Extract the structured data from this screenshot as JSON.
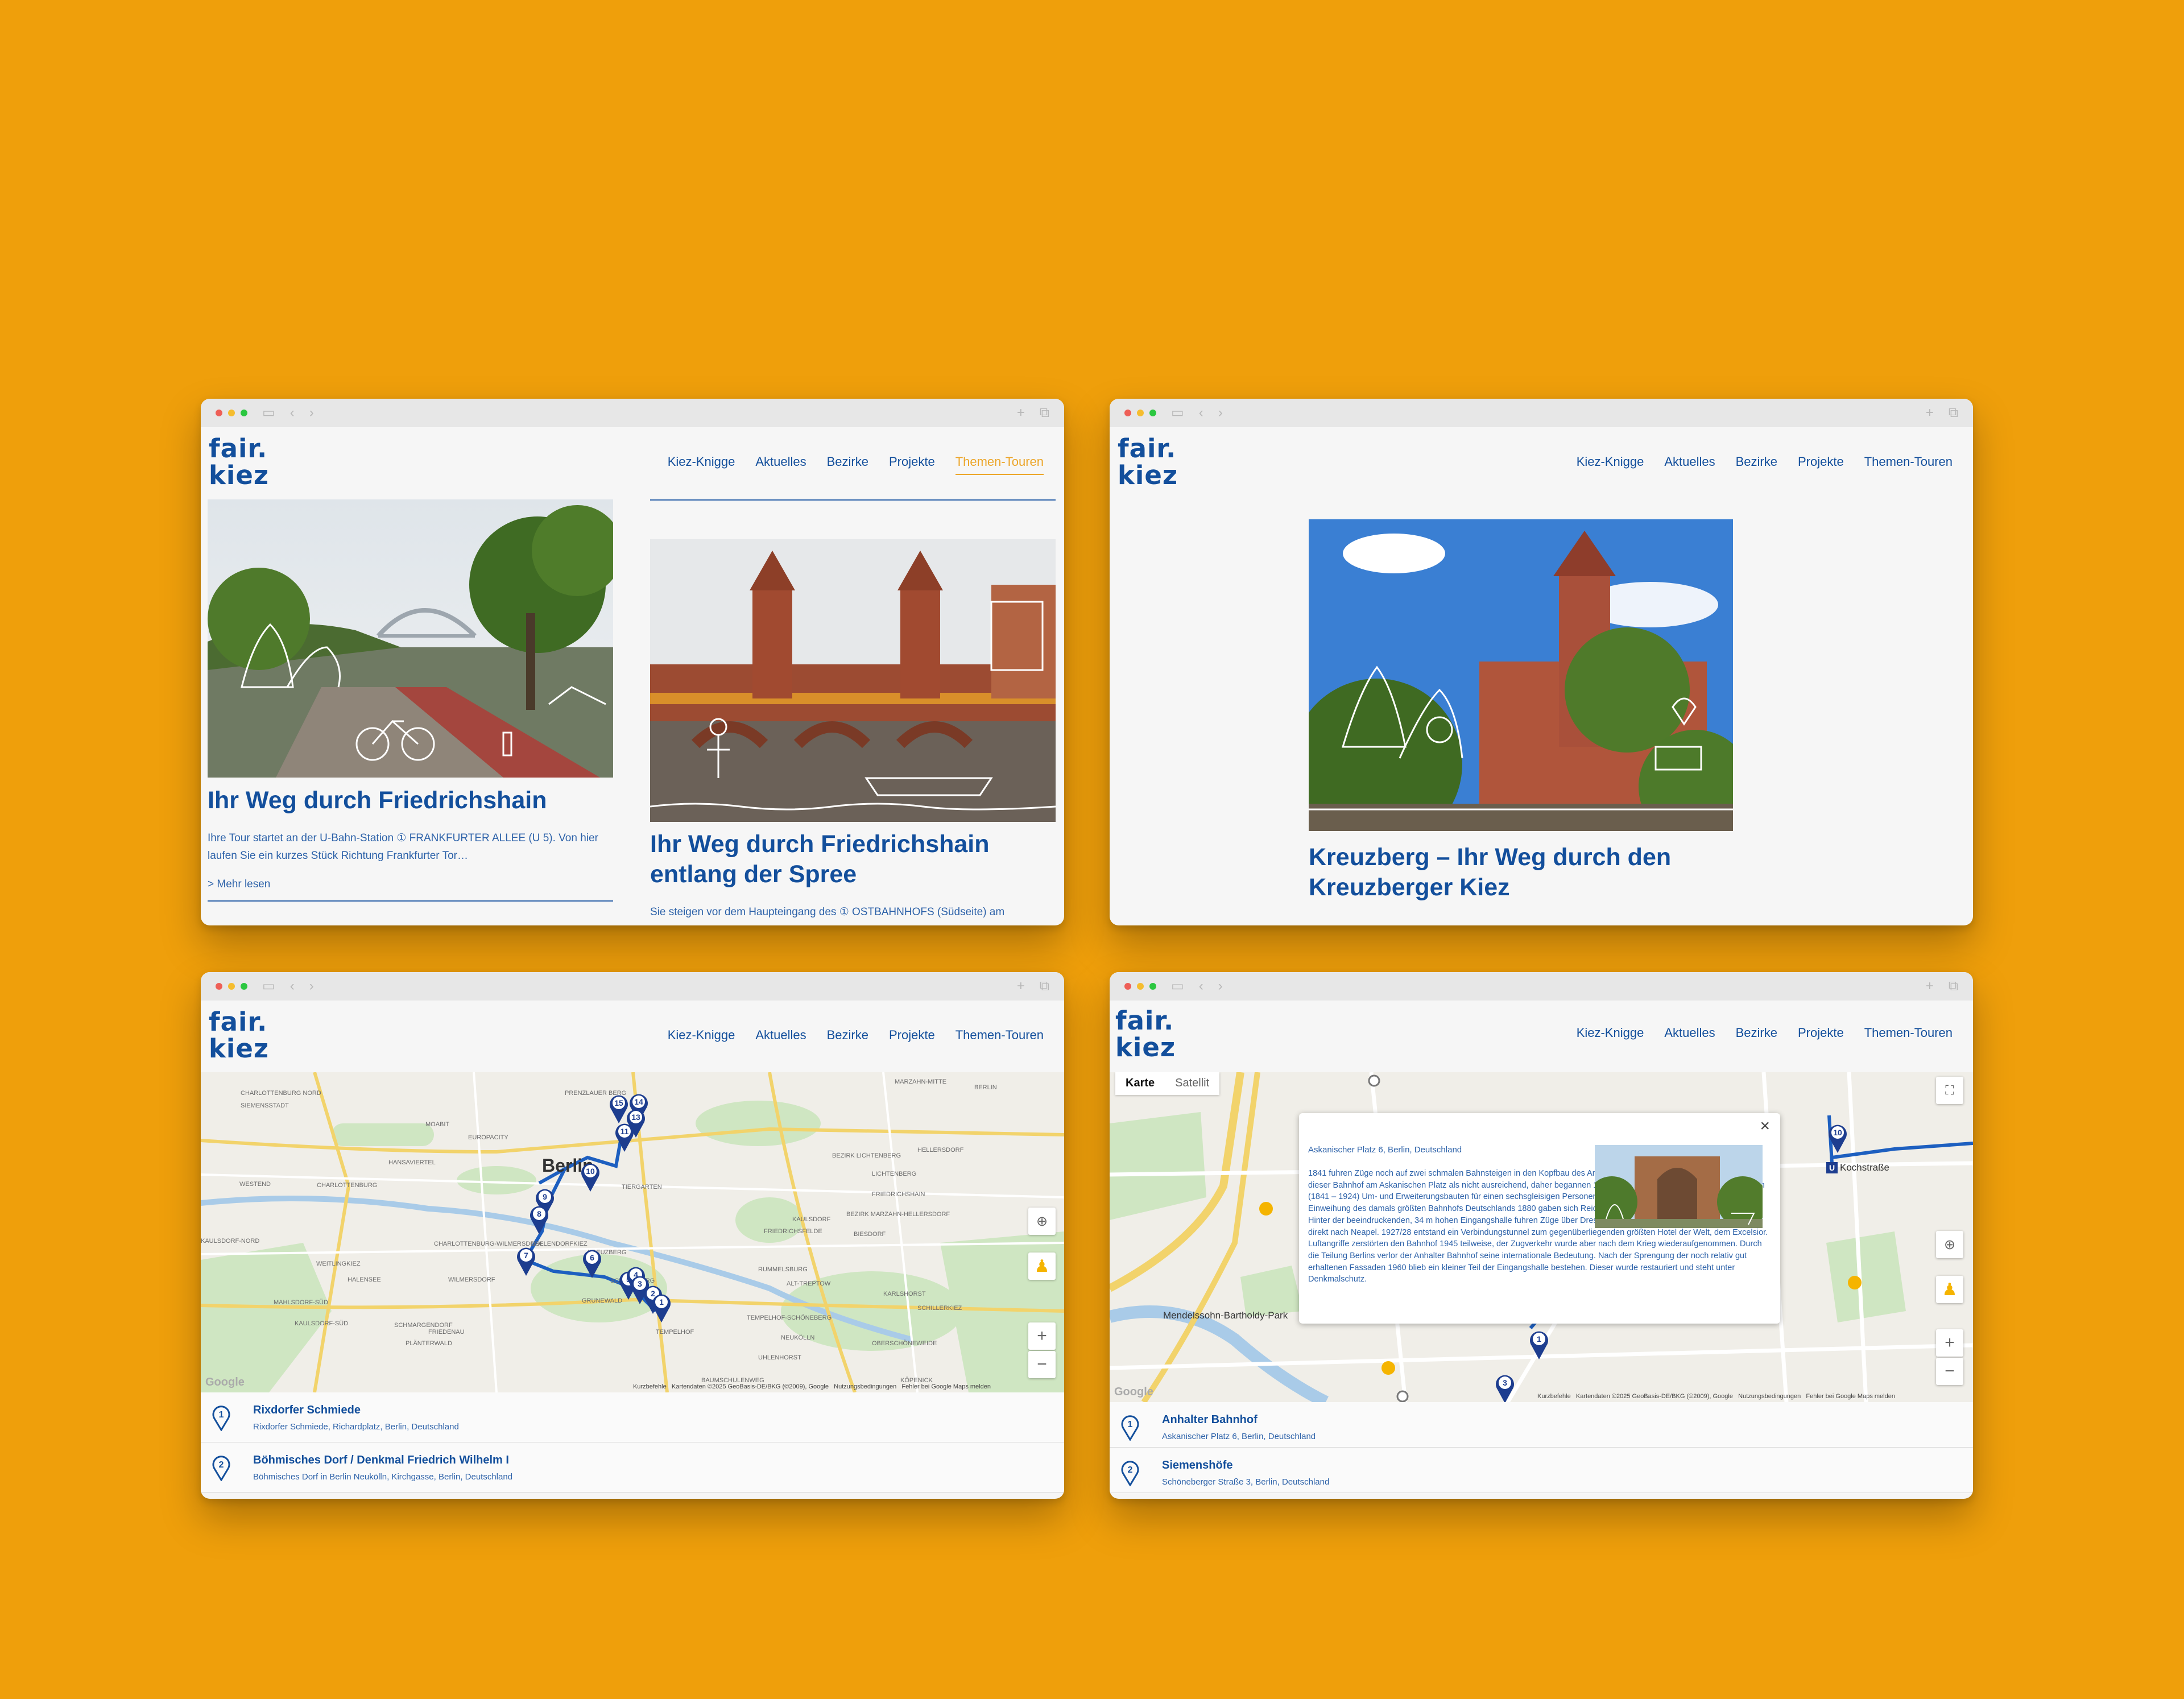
{
  "logo": {
    "line1": "fair.",
    "line2": "kiez"
  },
  "nav": [
    "Kiez-Knigge",
    "Aktuelles",
    "Bezirke",
    "Projekte",
    "Themen-Touren"
  ],
  "colors": {
    "background": "#ef9f0b",
    "brand_blue": "#134f9c",
    "accent": "#eca528"
  },
  "chrome_icons": [
    "sidebar-icon",
    "back-icon",
    "forward-icon",
    "new-tab-icon",
    "tabs-icon"
  ],
  "window1": {
    "card1": {
      "title": "Ihr Weg durch Friedrichshain",
      "text": "Ihre Tour startet an der U-Bahn-Station ① FRANKFURTER ALLEE (U 5). Von hier laufen Sie ein kurzes Stück Richtung Frankfurter Tor…",
      "more": "> Mehr lesen"
    },
    "card2": {
      "title": "Ihr Weg durch Friedrichshain entlang der Spree",
      "text": "Sie steigen vor dem Haupteingang des ① OSTBAHNHOFS (Südseite) am"
    }
  },
  "window2": {
    "title": "Kreuzberg – Ihr Weg durch den Kreuzberger Kiez"
  },
  "window3": {
    "map_labels": [
      "MARZAHN-MITTE",
      "PRENZLAUER BERG",
      "BERLIN",
      "CHARLOTTENBURG NORD",
      "SIEMENSSTADT",
      "MOABIT",
      "EUROPACITY",
      "HANSAVIERTEL",
      "BEZIRK LICHTENBERG",
      "HELLERSDORF",
      "Berlin",
      "LICHTENBERG",
      "WESTEND",
      "CHARLOTTENBURG",
      "TIERGARTEN",
      "FRIEDRICHSHAIN",
      "BEZIRK MARZAHN-HELLERSDORF",
      "KAULSDORF",
      "FRIEDRICHSFELDE",
      "BIESDORF",
      "KAULSDORF-NORD",
      "CHARLOTTENBURG-WILMERSDORF",
      "NOLLENDORFKIEZ",
      "KREUZBERG",
      "RUMMELSBURG",
      "WEITLINGKIEZ",
      "HALENSEE",
      "WILMERSDORF",
      "SCHÖNEBERG",
      "ALT-TREPTOW",
      "KARLSHORST",
      "MAHLSDORF-SÜD",
      "GRUNEWALD",
      "SCHILLERKIEZ",
      "KAULSDORF-SÜD",
      "SCHMARGENDORF",
      "FRIEDENAU",
      "TEMPELHOF-SCHÖNEBERG",
      "PLÄNTERWALD",
      "TEMPELHOF",
      "NEUKÖLLN",
      "OBERSCHÖNEWEIDE",
      "UHLENHORST",
      "BAUMSCHULENWEG",
      "KÖPENICK"
    ],
    "markers": [
      "15",
      "14",
      "13",
      "11",
      "10",
      "9",
      "8",
      "7",
      "6",
      "5",
      "4",
      "3",
      "2",
      "1"
    ],
    "map_brand": "Google",
    "attribution": [
      "Kurzbefehle",
      "Kartendaten ©2025 GeoBasis-DE/BKG (©2009), Google",
      "Nutzungsbedingungen",
      "Fehler bei Google Maps melden"
    ],
    "controls": [
      "recenter-icon",
      "pegman-icon",
      "+",
      "−"
    ],
    "list": [
      {
        "num": "1",
        "title": "Rixdorfer Schmiede",
        "sub": "Rixdorfer Schmiede, Richardplatz, Berlin, Deutschland"
      },
      {
        "num": "2",
        "title": "Böhmisches Dorf / Denkmal Friedrich Wilhelm I",
        "sub": "Böhmisches Dorf in Berlin Neukölln, Kirchgasse, Berlin, Deutschland"
      }
    ]
  },
  "window4": {
    "map_tabs": [
      "Karte",
      "Satellit"
    ],
    "popup": {
      "address": "Askanischer Platz 6, Berlin, Deutschland",
      "text": "1841 fuhren Züge noch auf zwei schmalen Bahnsteigen in den Kopfbau des Anhalter Bahnhofes ein. Schnell erwies sich dieser Bahnhof am Askanischen Platz als nicht ausreichend, daher begannen 1872 unter dem Architekten Franz Schwechten (1841 – 1924) Um- und Erweiterungsbauten für einen sechsgleisigen Personenbahnhof und einen Güterbahnhof. Zur Einweihung des damals größten Bahnhofs Deutschlands 1880 gaben sich Reichskanzler Bismarck und Wilhelm I. die Ehre. Hinter der beeindruckenden, 34 m hohen Eingangshalle fuhren Züge über Dresden nach Wien, Rom, Athen, später sogar direkt nach Neapel. 1927/28 entstand ein Verbindungstunnel zum gegenüberliegenden größten Hotel der Welt, dem Excelsior. Luftangriffe zerstörten den Bahnhof 1945 teilweise, der Zugverkehr wurde aber nach dem Krieg wiederaufgenommen. Durch die Teilung Berlins verlor der Anhalter Bahnhof seine internationale Bedeutung. Nach der Sprengung der noch relativ gut erhaltenen Fassaden 1960 blieb ein kleiner Teil der Eingangshalle bestehen. Dieser wurde restauriert und steht unter Denkmalschutz.",
      "close": "×"
    },
    "map_labels": [
      "Kochstraße",
      "Mendelssohn-Bartholdy-Park"
    ],
    "markers": [
      "10",
      "1",
      "3"
    ],
    "map_brand": "Google",
    "attribution": [
      "Kurzbefehle",
      "Kartendaten ©2025 GeoBasis-DE/BKG (©2009), Google",
      "Nutzungsbedingungen",
      "Fehler bei Google Maps melden"
    ],
    "controls": [
      "fullscreen-icon",
      "recenter-icon",
      "pegman-icon",
      "+",
      "−"
    ],
    "list": [
      {
        "num": "1",
        "title": "Anhalter Bahnhof",
        "sub": "Askanischer Platz 6, Berlin, Deutschland"
      },
      {
        "num": "2",
        "title": "Siemenshöfe",
        "sub": "Schöneberger Straße 3, Berlin, Deutschland"
      }
    ]
  }
}
